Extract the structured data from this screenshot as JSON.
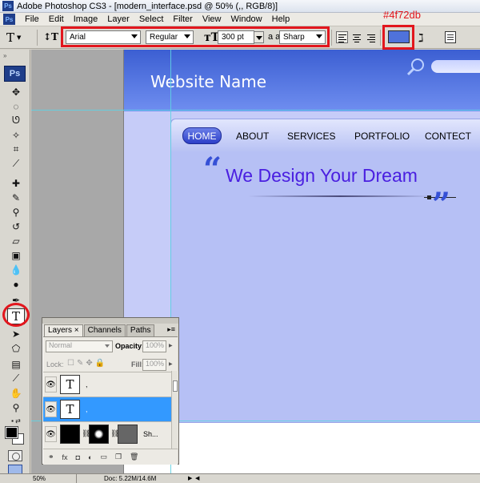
{
  "window": {
    "title": "Adobe Photoshop CS3 - [modern_interface.psd @ 50% (,, RGB/8)]",
    "logo_text": "Ps"
  },
  "menu": [
    "File",
    "Edit",
    "Image",
    "Layer",
    "Select",
    "Filter",
    "View",
    "Window",
    "Help"
  ],
  "options": {
    "tool_glyph": "T",
    "font_family": "Arial",
    "font_style": "Regular",
    "font_size": "300 pt",
    "aa_label": "a a",
    "antialias": "Sharp",
    "text_color": "#4f72db",
    "color_annotation": "#4f72db"
  },
  "toolbox": {
    "logo": "Ps",
    "active_tool_glyph": "T",
    "foreground_color": "#000000",
    "background_color": "#ffffff"
  },
  "canvas": {
    "site_name": "Website Name",
    "nav": [
      "HOME",
      "ABOUT",
      "SERVICES",
      "PORTFOLIO",
      "CONTECT"
    ],
    "tagline": "We Design Your Dream",
    "quote_open": "“",
    "quote_close": "”",
    "header_color": "#4f72db",
    "tagline_color": "#4a1fe0"
  },
  "layers_panel": {
    "tabs": [
      "Layers",
      "Channels",
      "Paths"
    ],
    "tab_close": "×",
    "blend_mode": "Normal",
    "opacity_label": "Opacity:",
    "opacity_value": "100%",
    "lock_label": "Lock:",
    "fill_label": "Fill:",
    "fill_value": "100%",
    "layers": [
      {
        "thumb": "T",
        "name": ",",
        "selected": false
      },
      {
        "thumb": "T",
        "name": ",",
        "selected": true
      },
      {
        "thumb": "",
        "name": "Sh...",
        "selected": false
      }
    ]
  },
  "status": {
    "zoom": "50%",
    "doc": "Doc: 5.22M/14.6M"
  }
}
